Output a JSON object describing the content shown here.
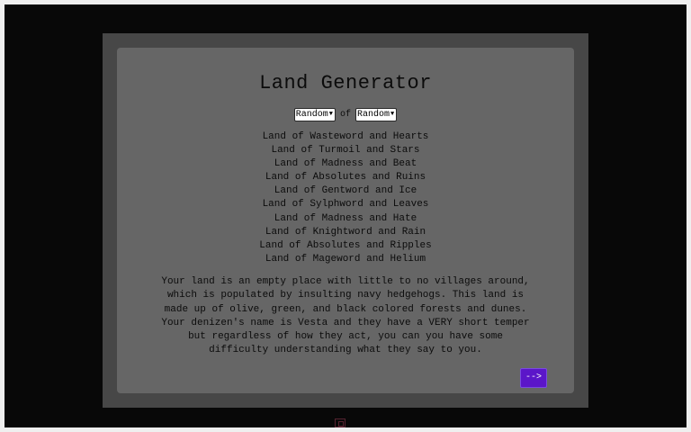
{
  "app": {
    "title": "Land Generator"
  },
  "selectors": {
    "first_value": "Random",
    "connector": "of",
    "second_value": "Random"
  },
  "lands": [
    "Land of Wasteword and Hearts",
    "Land of Turmoil and Stars",
    "Land of Madness and Beat",
    "Land of Absolutes and Ruins",
    "Land of Gentword and Ice",
    "Land of Sylphword and Leaves",
    "Land of Madness and Hate",
    "Land of Knightword and Rain",
    "Land of Absolutes and Ripples",
    "Land of Mageword and Helium"
  ],
  "description": "Your land is an empty place with little to no villages around, which is populated by insulting navy hedgehogs. This land is made up of olive, green, and black colored forests and dunes. Your denizen's name is Vesta and they have a VERY short temper but regardless of how they act, you can you have some difficulty understanding what they say to you.",
  "next_button": {
    "label": "-->"
  },
  "colors": {
    "screen_bg": "#080808",
    "frame_bg": "#474747",
    "panel_bg": "#666666",
    "accent": "#5b16c9"
  },
  "icons": {
    "bottom": "resize-icon"
  }
}
